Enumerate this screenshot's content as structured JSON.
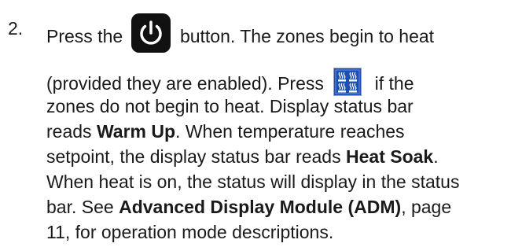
{
  "step": {
    "number": "2.",
    "l1a": "Press the",
    "l1b": "button. The zones begin to heat",
    "l2a": "(provided they are enabled). Press",
    "l2b": "if the",
    "l3": "zones do not begin to heat. Display status bar",
    "l4a": "reads ",
    "l4b": "Warm Up",
    "l4c": ". When temperature reaches",
    "l5a": "setpoint, the display status bar reads ",
    "l5b": "Heat Soak",
    "l5c": ".",
    "l6": "When heat is on, the status will display in the status",
    "l7a": "bar. See ",
    "l7b": "Advanced Display Module (ADM)",
    "l7c": ", page",
    "l8": "11, for operation mode descriptions."
  },
  "icons": {
    "power": "power-icon",
    "heat": "heat-zones-icon"
  }
}
